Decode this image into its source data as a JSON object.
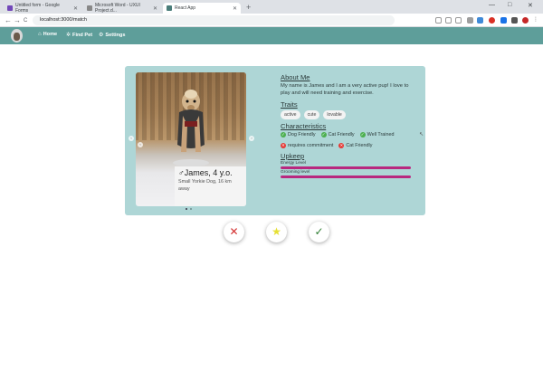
{
  "browser": {
    "tabs": [
      {
        "label": "Untitled form - Google Forms",
        "favicon_color": "#7248b9"
      },
      {
        "label": "Microsoft Word - UXUI Project.d...",
        "favicon_color": "#888888"
      },
      {
        "label": "React App",
        "favicon_color": "#4a7d7a"
      }
    ],
    "new_tab": "+",
    "url": "localhost:3000/match",
    "back": "←",
    "forward": "→",
    "reload": "C",
    "window_min": "—",
    "window_max": "□",
    "window_close": "✕"
  },
  "navbar": {
    "items": [
      {
        "label": "Home",
        "icon": "home-icon",
        "glyph": "⌂"
      },
      {
        "label": "Find Pet",
        "icon": "paw-icon",
        "glyph": "🐾"
      },
      {
        "label": "Settings",
        "icon": "gear-icon",
        "glyph": "⚙"
      }
    ]
  },
  "profile": {
    "name": "♂James, 4 y.o.",
    "description": "Small Yorkie Dog, 16 km away",
    "about_heading": "About Me",
    "about_text": "My name is James and I am a very active pup! I love to play and will need training and exercise.",
    "traits_heading": "Traits",
    "traits": [
      "active",
      "cute",
      "lovable"
    ],
    "characteristics_heading": "Characteristics",
    "characteristics": [
      {
        "label": "Dog Friendly",
        "positive": true
      },
      {
        "label": "Cat Friendly",
        "positive": true
      },
      {
        "label": "Well Trained",
        "positive": true
      },
      {
        "label": "requires commitment",
        "positive": false
      },
      {
        "label": "Cat Friendly",
        "positive": false
      }
    ],
    "upkeep_heading": "Upkeep",
    "upkeep": [
      {
        "label": "Energy Level",
        "level": 1.0
      },
      {
        "label": "Grooming level",
        "level": 1.0
      }
    ],
    "carousel_prev": "‹",
    "carousel_next": "›"
  },
  "actions": {
    "reject": "✕",
    "favorite": "★",
    "accept": "✓"
  },
  "colors": {
    "nav": "#5e9e9a",
    "card": "#aed6d6",
    "bar_fill": "#b8287f",
    "reject": "#d32f2f",
    "favorite": "#e6e034",
    "accept": "#2e7d32"
  }
}
